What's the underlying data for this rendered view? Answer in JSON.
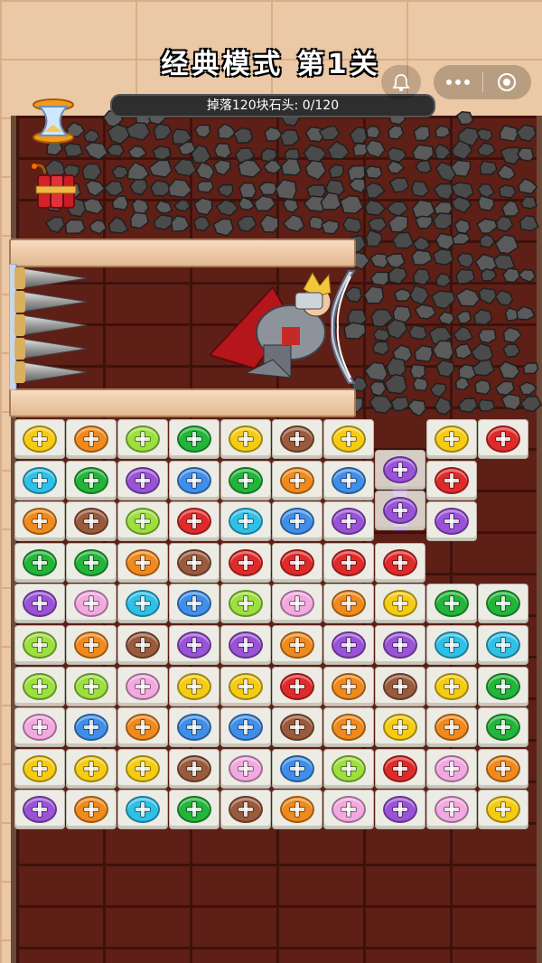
{
  "header": {
    "title": "经典模式 第1关",
    "progress_text": "掉落120块石头: 0/120"
  },
  "tools": [
    {
      "name": "hourglass-icon"
    },
    {
      "name": "dynamite-icon"
    }
  ],
  "system": {
    "bell": "bell-icon",
    "more": "more-icon",
    "close": "target-icon"
  },
  "colors": {
    "yellow": "#f6cc13",
    "orange": "#f08a1c",
    "lime": "#9be03c",
    "green": "#22b53a",
    "brown": "#9a5a3c",
    "red": "#e02a2a",
    "cyan": "#2ec1e8",
    "purple": "#9a52d8",
    "blue": "#3f8fea",
    "pink": "#f3a8e0"
  },
  "grid": [
    [
      "yellow",
      "orange",
      "lime",
      "green",
      "yellow",
      "brown",
      "yellow",
      null,
      "yellow",
      "red"
    ],
    [
      "cyan",
      "green",
      "purple",
      "blue",
      "green",
      "orange",
      "blue",
      null,
      "red",
      null
    ],
    [
      "orange",
      "brown",
      "lime",
      "red",
      "cyan",
      "blue",
      "purple",
      null,
      "purple",
      null
    ],
    [
      "green",
      "green",
      "orange",
      "brown",
      "red",
      "red",
      "red",
      "red",
      null,
      null
    ],
    [
      "purple",
      "pink",
      "cyan",
      "blue",
      "lime",
      "pink",
      "orange",
      "yellow",
      "green",
      "green"
    ],
    [
      "lime",
      "orange",
      "brown",
      "purple",
      "purple",
      "orange",
      "purple",
      "purple",
      "cyan",
      "cyan"
    ],
    [
      "lime",
      "lime",
      "pink",
      "yellow",
      "yellow",
      "red",
      "orange",
      "brown",
      "yellow",
      "green"
    ],
    [
      "pink",
      "blue",
      "orange",
      "blue",
      "blue",
      "brown",
      "orange",
      "yellow",
      "orange",
      "green"
    ],
    [
      "yellow",
      "yellow",
      "yellow",
      "brown",
      "pink",
      "blue",
      "lime",
      "red",
      "pink",
      "orange"
    ],
    [
      "purple",
      "orange",
      "cyan",
      "green",
      "brown",
      "orange",
      "pink",
      "purple",
      "pink",
      "yellow"
    ]
  ],
  "floating_screws": [
    {
      "color": "purple",
      "row": 1,
      "col": 7
    },
    {
      "color": "purple",
      "row": 2,
      "col": 7
    }
  ]
}
